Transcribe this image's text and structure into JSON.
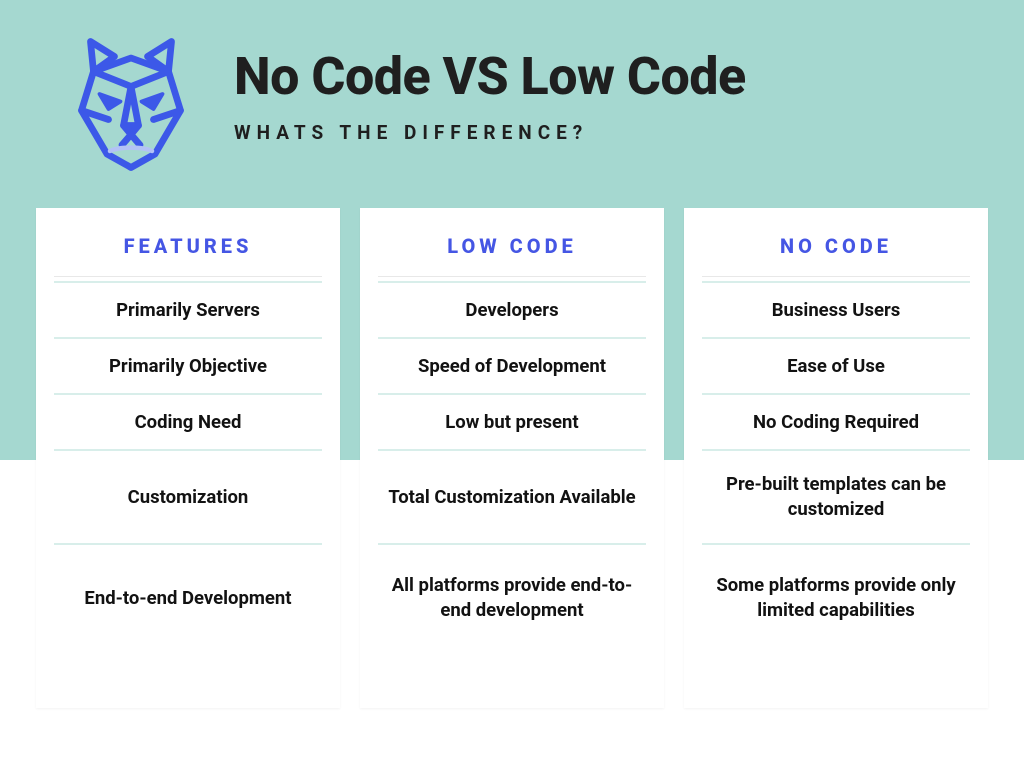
{
  "header": {
    "title": "No Code VS Low Code",
    "subtitle": "WHATS THE DIFFERENCE?"
  },
  "columns": {
    "features": {
      "title": "FEATURES",
      "rows": [
        "Primarily Servers",
        "Primarily Objective",
        "Coding Need",
        "Customization",
        "End-to-end Development"
      ]
    },
    "low_code": {
      "title": "LOW CODE",
      "rows": [
        "Developers",
        "Speed of Development",
        "Low but present",
        "Total Customization Available",
        "All platforms provide end-to-end development"
      ]
    },
    "no_code": {
      "title": "NO CODE",
      "rows": [
        "Business Users",
        "Ease of Use",
        "No Coding Required",
        "Pre-built templates can be customized",
        "Some platforms provide only limited capabilities"
      ]
    }
  },
  "logo": {
    "name": "tiger-face-outline",
    "color": "#3c58e8"
  }
}
